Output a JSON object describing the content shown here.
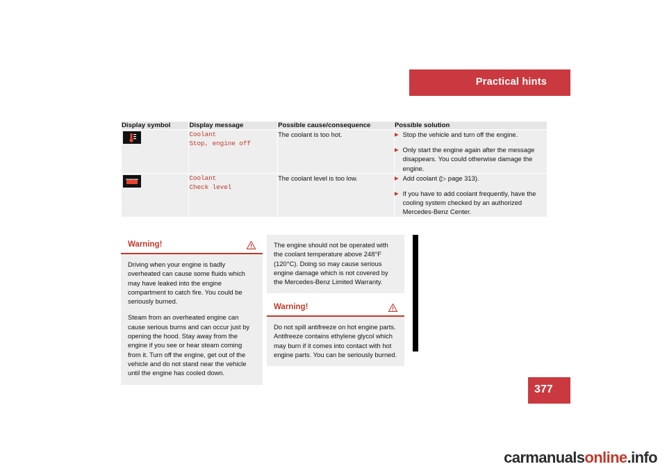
{
  "header": {
    "title": "Practical hints"
  },
  "page_number": "377",
  "table": {
    "headers": [
      "Display symbol",
      "Display message",
      "Possible cause/consequence",
      "Possible solution"
    ],
    "rows": [
      {
        "symbol_name": "coolant-temperature-warning-icon",
        "message_lines": [
          "Coolant",
          "Stop, engine off"
        ],
        "cause": "The coolant is too hot.",
        "solutions": [
          {
            "bullet": "▶",
            "text": "Stop the vehicle and turn off the engine."
          },
          {
            "bullet": "▶",
            "text": "Only start the engine again after the message disappears. You could otherwise damage the engine."
          }
        ]
      },
      {
        "symbol_name": "coolant-level-warning-icon",
        "message_lines": [
          "Coolant",
          "Check level"
        ],
        "cause": "The coolant level is too low.",
        "solutions": [
          {
            "bullet": "▶",
            "text": "Add coolant (▷ page 313)."
          },
          {
            "bullet": "▶",
            "text": "If you have to add coolant frequently, have the cooling system checked by an authorized Mercedes-Benz Center."
          }
        ]
      }
    ]
  },
  "boxes": {
    "warning_left": {
      "title": "Warning!",
      "icon": "warning-triangle-icon",
      "paragraphs": [
        "Driving when your engine is badly overheated can cause some fluids which may have leaked into the engine compartment to catch fire. You could be seriously burned.",
        "Steam from an overheated engine can cause serious burns and can occur just by opening the hood. Stay away from the engine if you see or hear steam coming from it. Turn off the engine, get out of the vehicle and do not stand near the vehicle until the engine has cooled down."
      ]
    },
    "info": {
      "paragraphs": [
        "The engine should not be operated with the coolant temperature above 248°F (120°C). Doing so may cause serious engine damage which is not covered by the Mercedes-Benz Limited Warranty."
      ]
    },
    "warning_right": {
      "title": "Warning!",
      "icon": "warning-triangle-icon",
      "paragraphs": [
        "Do not spill antifreeze on hot engine parts. Antifreeze contains ethylene glycol which may burn if it comes into contact with hot engine parts. You can be seriously burned."
      ]
    }
  },
  "watermark": {
    "part1": "carmanuals",
    "part2": "online",
    "part3": ".info"
  },
  "colors": {
    "accent_red": "#c9393f",
    "text_red": "#c0392b",
    "table_header_bg": "#e6e6e6",
    "table_body_bg": "#eeeeee"
  }
}
